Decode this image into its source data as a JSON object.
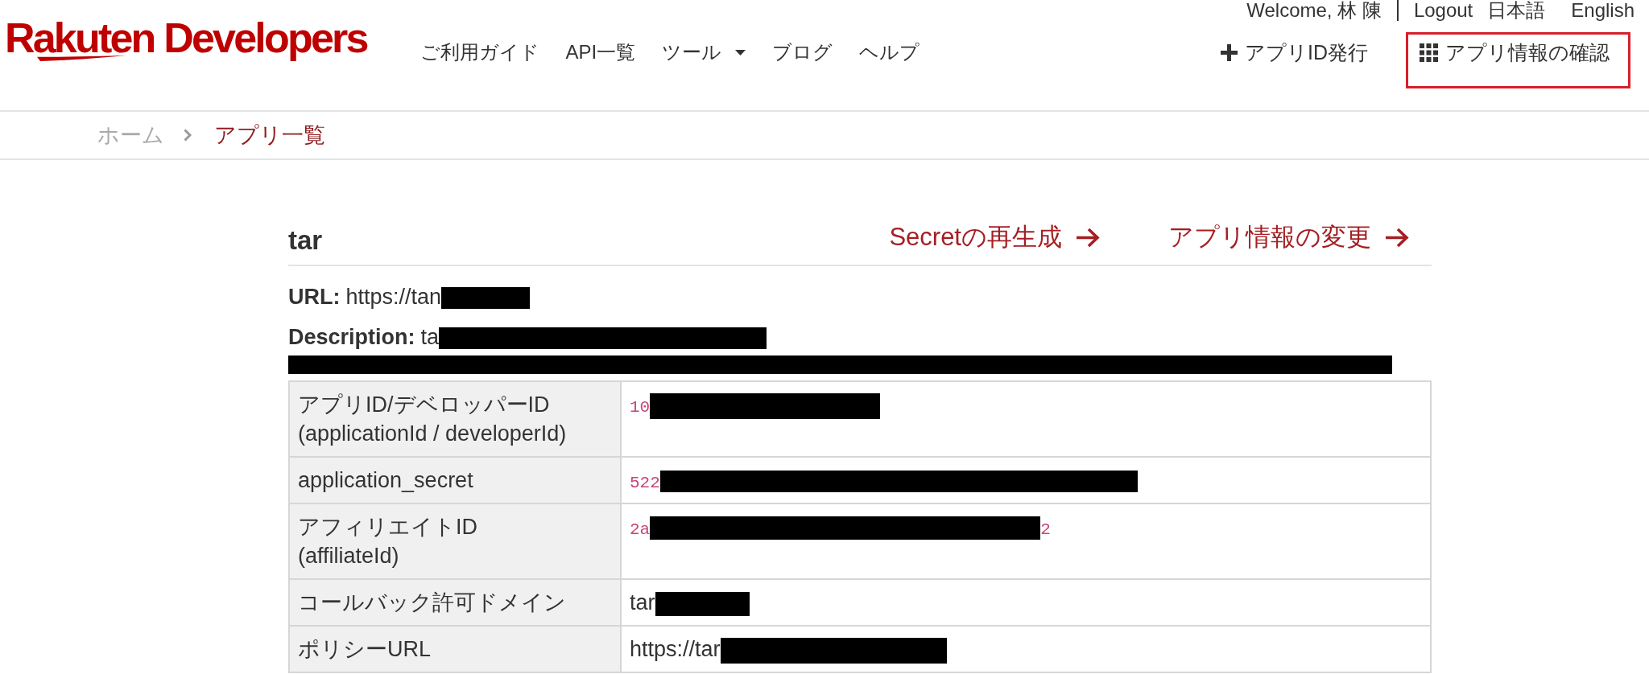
{
  "header": {
    "logo": "Rakuten Developers",
    "nav": [
      {
        "label": "ご利用ガイド",
        "kind": "link"
      },
      {
        "label": "API一覧",
        "kind": "link"
      },
      {
        "label": "ツール",
        "kind": "dropdown"
      },
      {
        "label": "ブログ",
        "kind": "link"
      },
      {
        "label": "ヘルプ",
        "kind": "link"
      }
    ],
    "user_bar": {
      "welcome": "Welcome, 林 陳",
      "logout": "Logout",
      "languages": [
        "日本語",
        "English"
      ]
    },
    "actions": [
      {
        "label": "アプリID発行",
        "kind": "add",
        "highlighted": false
      },
      {
        "label": "アプリ情報の確認",
        "kind": "grid",
        "highlighted": true
      }
    ]
  },
  "breadcrumb": [
    {
      "label": "ホーム",
      "current": false
    },
    {
      "label": "アプリ一覧",
      "current": true
    }
  ],
  "app": {
    "title": "tar",
    "links": [
      "Secretの再生成",
      "アプリ情報の変更"
    ],
    "url": {
      "label": "URL:",
      "segments": [
        {
          "kind": "text",
          "text": "https://tan"
        },
        {
          "kind": "redacted"
        }
      ]
    },
    "description": {
      "label": "Description:",
      "segments": [
        {
          "kind": "text",
          "text": "ta"
        },
        {
          "kind": "redacted"
        },
        {
          "kind": "redacted_line"
        }
      ]
    }
  },
  "table": {
    "rows": [
      {
        "label": "アプリID/デベロッパーID\n(applicationId / developerId)",
        "kind": "code",
        "segments": [
          {
            "kind": "text",
            "text": "10"
          },
          {
            "kind": "redacted"
          }
        ]
      },
      {
        "label": "application_secret",
        "kind": "code",
        "segments": [
          {
            "kind": "text",
            "text": "522"
          },
          {
            "kind": "redacted"
          }
        ]
      },
      {
        "label": "アフィリエイトID\n(affiliateId)",
        "kind": "code",
        "segments": [
          {
            "kind": "text",
            "text": "2a"
          },
          {
            "kind": "redacted"
          },
          {
            "kind": "text",
            "text": "2"
          }
        ]
      },
      {
        "label": "コールバック許可ドメイン",
        "kind": "text",
        "segments": [
          {
            "kind": "text",
            "text": "tar"
          },
          {
            "kind": "redacted"
          }
        ]
      },
      {
        "label": "ポリシーURL",
        "kind": "text",
        "segments": [
          {
            "kind": "text",
            "text": "https://tar"
          },
          {
            "kind": "redacted"
          }
        ]
      }
    ]
  }
}
